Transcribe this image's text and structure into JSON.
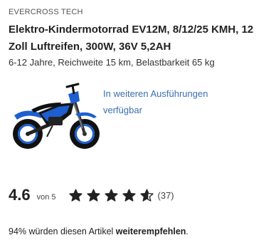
{
  "product": {
    "brand": "EVERCROSS TECH",
    "title": "Elektro-Kindermotorrad EV12M, 8/12/25 KMH, 12 Zoll Luftreifen, 300W, 36V 5,2AH",
    "subtitle": "6-12 Jahre, Reichweite 15 km, Belastbarkeit 65 kg",
    "variants_link": "In weiteren Ausführungen verfügbar"
  },
  "rating": {
    "value": "4.6",
    "max_label": "von 5",
    "stars_filled": 4.6,
    "stars_total": 5,
    "review_count": "(37)"
  },
  "recommendation": {
    "prefix": "94% würden diesen Artikel ",
    "emphasis": "weiterempfehlen",
    "suffix": "."
  },
  "colors": {
    "accent_link": "#3a6fb0",
    "motorbike_blue": "#1d5fd0",
    "motorbike_black": "#151515",
    "star": "#222222"
  }
}
